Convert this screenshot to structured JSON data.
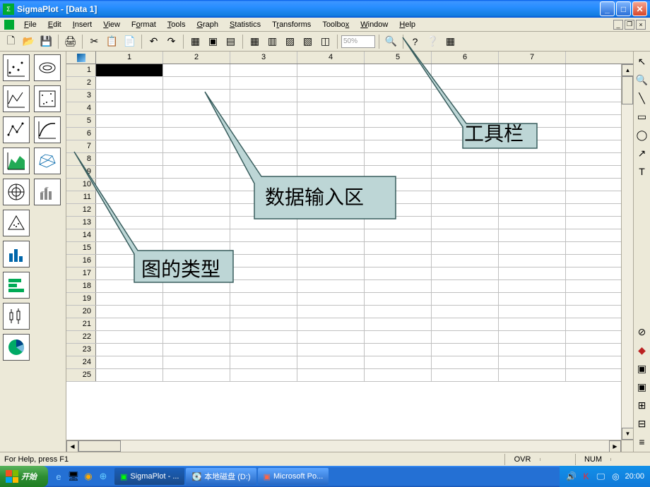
{
  "title": "SigmaPlot - [Data 1]",
  "menus": [
    "File",
    "Edit",
    "Insert",
    "View",
    "Format",
    "Tools",
    "Graph",
    "Statistics",
    "Transforms",
    "Toolbox",
    "Window",
    "Help"
  ],
  "menu_keys": [
    "F",
    "E",
    "I",
    "V",
    "o",
    "T",
    "G",
    "S",
    "r",
    "x",
    "W",
    "H"
  ],
  "toolbar": {
    "zoom": "50%"
  },
  "columns": [
    "1",
    "2",
    "3",
    "4",
    "5",
    "6",
    "7"
  ],
  "rows": [
    "1",
    "2",
    "3",
    "4",
    "5",
    "6",
    "7",
    "8",
    "9",
    "10",
    "11",
    "12",
    "13",
    "14",
    "15",
    "16",
    "17",
    "18",
    "19",
    "20",
    "21",
    "22",
    "23",
    "24",
    "25"
  ],
  "statusbar": {
    "help": "For Help, press F1",
    "ovr": "OVR",
    "num": "NUM"
  },
  "callouts": {
    "toolbar": "工具栏",
    "dataarea": "数据输入区",
    "graphtype": "图的类型"
  },
  "taskbar": {
    "start": "开始",
    "items": [
      "SigmaPlot - ...",
      "本地磁盘 (D:)",
      "Microsoft Po..."
    ],
    "time": "20:00"
  }
}
